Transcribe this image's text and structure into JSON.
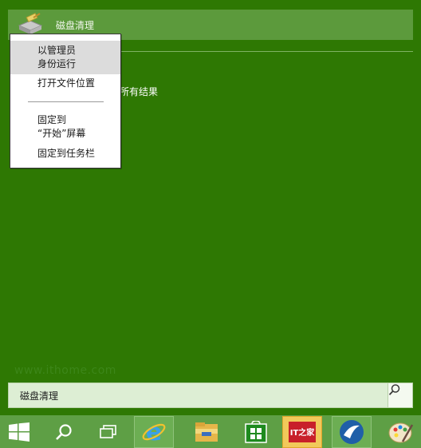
{
  "search_results": {
    "top_item_label": "磁盘清理",
    "all_results_fragment": "所有结果"
  },
  "context_menu": {
    "run_as_admin_line1": "以管理员",
    "run_as_admin_line2": "身份运行",
    "open_file_location": "打开文件位置",
    "pin_to_start_line1": "固定到",
    "pin_to_start_line2": "“开始”屏幕",
    "pin_to_taskbar": "固定到任务栏"
  },
  "watermark": "www.ithome.com",
  "search_box": {
    "value": "磁盘清理"
  },
  "taskbar": {
    "ithome_icon_text": "IT之家",
    "icons": [
      "windows-start-icon",
      "search-icon",
      "task-view-icon",
      "internet-explorer-icon",
      "file-explorer-icon",
      "store-icon",
      "ithome-icon",
      "app-blue-icon",
      "paint-icon"
    ]
  },
  "colors": {
    "background": "#2e7803",
    "highlight": "#5c9a3c",
    "taskbar": "#5e9f45",
    "menu_hover": "#dcdcdc"
  }
}
